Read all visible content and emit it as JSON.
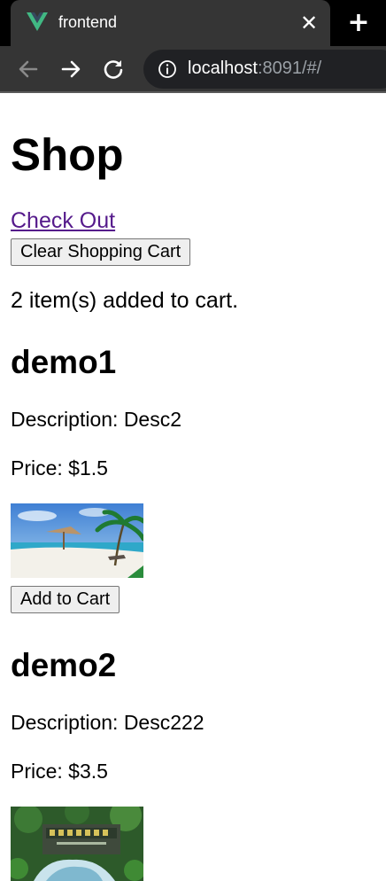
{
  "browser": {
    "tab_title": "frontend",
    "url_host": "localhost",
    "url_rest": ":8091/#/"
  },
  "shop": {
    "title": "Shop",
    "checkout_label": "Check Out",
    "clear_cart_label": "Clear Shopping Cart",
    "cart_status": "2 item(s) added to cart."
  },
  "products": [
    {
      "name": "demo1",
      "description": "Description: Desc2",
      "price": "Price: $1.5",
      "image_subject": "beach-photo",
      "add_label": "Add to Cart"
    },
    {
      "name": "demo2",
      "description": "Description: Desc222",
      "price": "Price: $3.5",
      "image_subject": "park-sign-photo"
    }
  ],
  "colors": {
    "chrome_dark": "#353535",
    "tabstrip": "#000000",
    "link_visited": "#551a8b",
    "vue_green": "#41b883"
  }
}
